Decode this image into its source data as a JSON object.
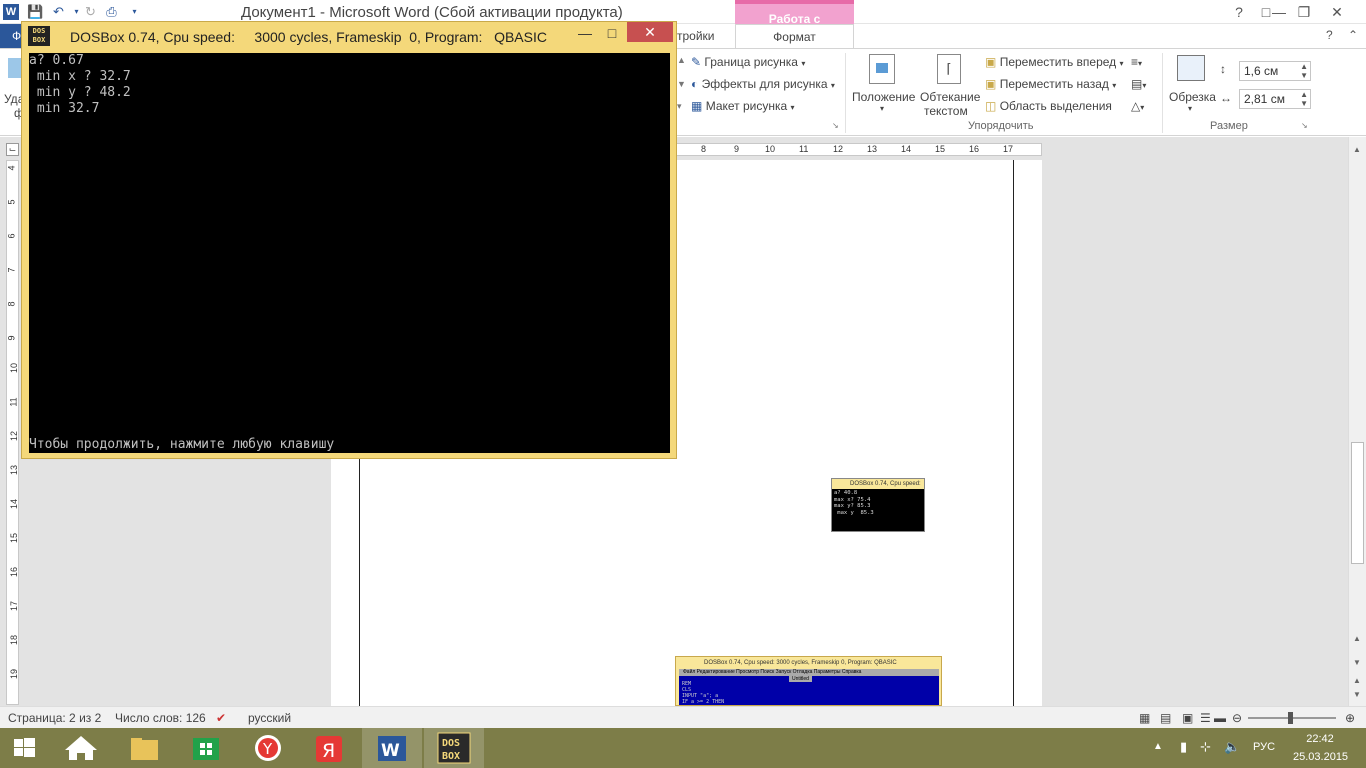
{
  "word": {
    "title": "Документ1  -  Microsoft Word (Сбой активации продукта)",
    "contextual_group": "Работа с рисунками",
    "tabs": {
      "file": "Ф",
      "settings_partial": "тройки",
      "format": "Формат"
    },
    "ribbon": {
      "border_label": "Граница рисунка",
      "effects_label": "Эффекты для рисунка",
      "layout_label": "Макет рисунка",
      "position_label": "Положение",
      "wrap_label_1": "Обтекание",
      "wrap_label_2": "текстом",
      "forward_label": "Переместить вперед",
      "backward_label": "Переместить назад",
      "selection_label": "Область выделения",
      "arrange_group": "Упорядочить",
      "crop_label": "Обрезка",
      "height_value": "1,6 см",
      "width_value": "2,81 см",
      "size_group": "Размер",
      "left_partial_1": "Уда",
      "left_partial_2": "ф"
    },
    "ruler_h": [
      "8",
      "9",
      "10",
      "11",
      "12",
      "13",
      "14",
      "15",
      "16",
      "17"
    ],
    "ruler_v": [
      "4",
      "5",
      "6",
      "7",
      "8",
      "9",
      "10",
      "11",
      "12",
      "13",
      "14",
      "15",
      "16",
      "17",
      "18",
      "19"
    ],
    "status": {
      "page": "Страница: 2 из 2",
      "words": "Число слов: 126",
      "language": "русский"
    }
  },
  "dosbox": {
    "title": "DOSBox 0.74, Cpu speed:     3000 cycles, Frameskip  0, Program:   QBASIC",
    "logo": "DOS\nBOX",
    "output_lines": [
      "a? 0.67",
      " min x ? 32.7",
      " min y ? 48.2",
      " min 32.7"
    ],
    "prompt": "Чтобы продолжить, нажмите любую клавишу"
  },
  "embedded_small": {
    "caption": "DOSBox 0.74, Cpu speed:",
    "text": "a? 40.8\nmax x? 75.4\nmax y? 85.3\n max y  85.3"
  },
  "embedded_qbasic": {
    "caption": "DOSBox 0.74, Cpu speed:     3000 cycles, Frameskip  0, Program:  QBASIC",
    "menu": "Файл   Редактирование  Просмотр  Поиск  Запуск  Отладка  Параметры     Справка",
    "doc_title": "Untitled",
    "code": "REM\nCLS\nINPUT \"a\"; a\nIF a >= 2 THEN"
  },
  "taskbar": {
    "language": "РУС",
    "time": "22:42",
    "date": "25.03.2015"
  },
  "colors": {
    "word_blue": "#2b579a",
    "contextual_pink": "#f2a2cf",
    "dosbox_title": "#f4d87a",
    "taskbar": "#7d7d48"
  }
}
